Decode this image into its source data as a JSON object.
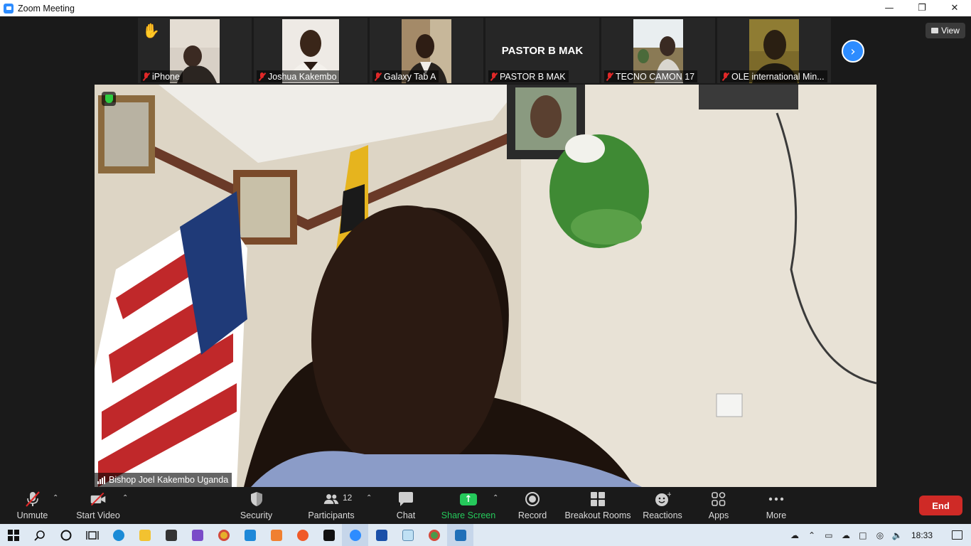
{
  "window": {
    "title": "Zoom Meeting",
    "controls": [
      "minimize",
      "restore",
      "close"
    ]
  },
  "view_button": {
    "label": "View"
  },
  "thumbnails": [
    {
      "name": "iPhone",
      "muted": true,
      "raised_hand": true,
      "has_video": true
    },
    {
      "name": "Joshua Kakembo",
      "muted": true,
      "has_video": true
    },
    {
      "name": "Galaxy Tab A",
      "muted": true,
      "has_video": true
    },
    {
      "name": "PASTOR B MAK",
      "muted": true,
      "has_video": false,
      "display_name": "PASTOR B MAK"
    },
    {
      "name": "TECNO CAMON 17",
      "muted": true,
      "has_video": true
    },
    {
      "name": "OLE international Min...",
      "muted": true,
      "has_video": true
    }
  ],
  "main_video": {
    "speaker_name": "Bishop Joel Kakembo Uganda",
    "encrypted": true
  },
  "toolbar": {
    "unmute": "Unmute",
    "start_video": "Start Video",
    "security": "Security",
    "participants": "Participants",
    "participants_count": "12",
    "chat": "Chat",
    "share_screen": "Share Screen",
    "record": "Record",
    "breakout_rooms": "Breakout Rooms",
    "reactions": "Reactions",
    "apps": "Apps",
    "more": "More",
    "end": "End"
  },
  "taskbar": {
    "apps": [
      "start",
      "search",
      "cortana",
      "task-view",
      "edge",
      "file-explorer",
      "store",
      "visual-studio",
      "chrome",
      "vscode",
      "app-orange",
      "app-orange-2",
      "photoshop",
      "zoom",
      "app-blue",
      "notepad",
      "chrome-2",
      "photos"
    ],
    "clock": "18:33"
  },
  "colors": {
    "accent_blue": "#2d8cff",
    "share_green": "#25c95b",
    "end_red": "#cf2a26",
    "mute_red": "#e02828"
  }
}
